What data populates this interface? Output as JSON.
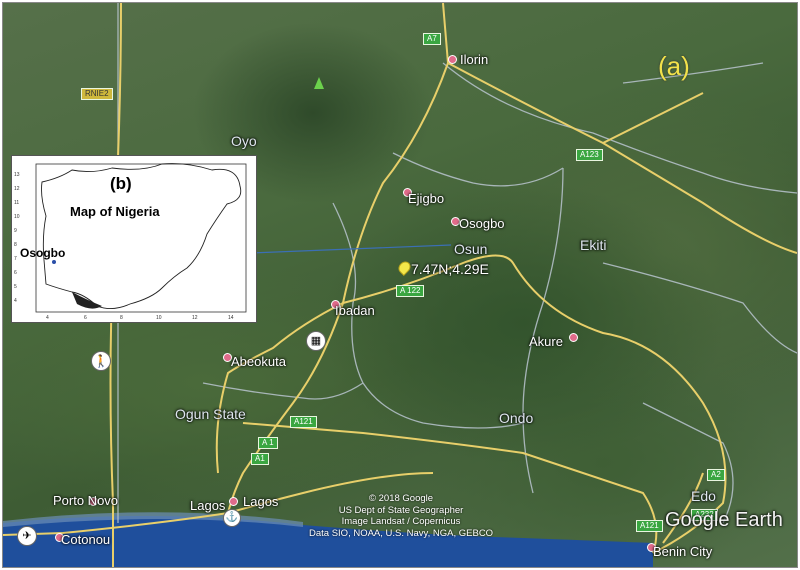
{
  "panel_label": "(a)",
  "places": {
    "ilorin": "Ilorin",
    "oyo": "Oyo",
    "ejigbo": "Ejigbo",
    "osogbo": "Osogbo",
    "osun": "Osun",
    "ekiti": "Ekiti",
    "ibadan": "Ibadan",
    "abeokuta": "Abeokuta",
    "akure": "Akure",
    "ogun_state": "Ogun State",
    "ondo": "Ondo",
    "porto_novo": "Porto Novo",
    "lagos": "Lagos",
    "cotonou": "Cotonou",
    "edo": "Edo",
    "benin_city": "Benin City"
  },
  "coordinate_label": "7.47N;4.29E",
  "road_shields": {
    "a7": "A7",
    "rnie2": "RNIE2",
    "a123": "A123",
    "a122": "A 122",
    "a121_west": "A121",
    "a1_upper": "A 1",
    "a1_lower": "A1",
    "a2": "A2",
    "a121_east": "A121",
    "a232": "A232"
  },
  "attribution": {
    "line1": "© 2018 Google",
    "line2": "US Dept of State Geographer",
    "line3": "Image Landsat / Copernicus",
    "line4": "Data SIO, NOAA, U.S. Navy, NGA, GEBCO"
  },
  "logo": "Google Earth",
  "inset": {
    "panel_label": "(b)",
    "title": "Map of Nigeria",
    "city_label": "Osogbo",
    "y_ticks": [
      "13",
      "12",
      "11",
      "10",
      "9",
      "8",
      "7",
      "6",
      "5",
      "4"
    ],
    "x_ticks": [
      "4",
      "6",
      "8",
      "10",
      "12",
      "14"
    ]
  },
  "colors": {
    "roads": "#e8cf6a",
    "borders": "#b9c4cf",
    "panel_label": "#f2e24a",
    "shield": "#3aa641",
    "ocean": "#1f4f9c"
  }
}
